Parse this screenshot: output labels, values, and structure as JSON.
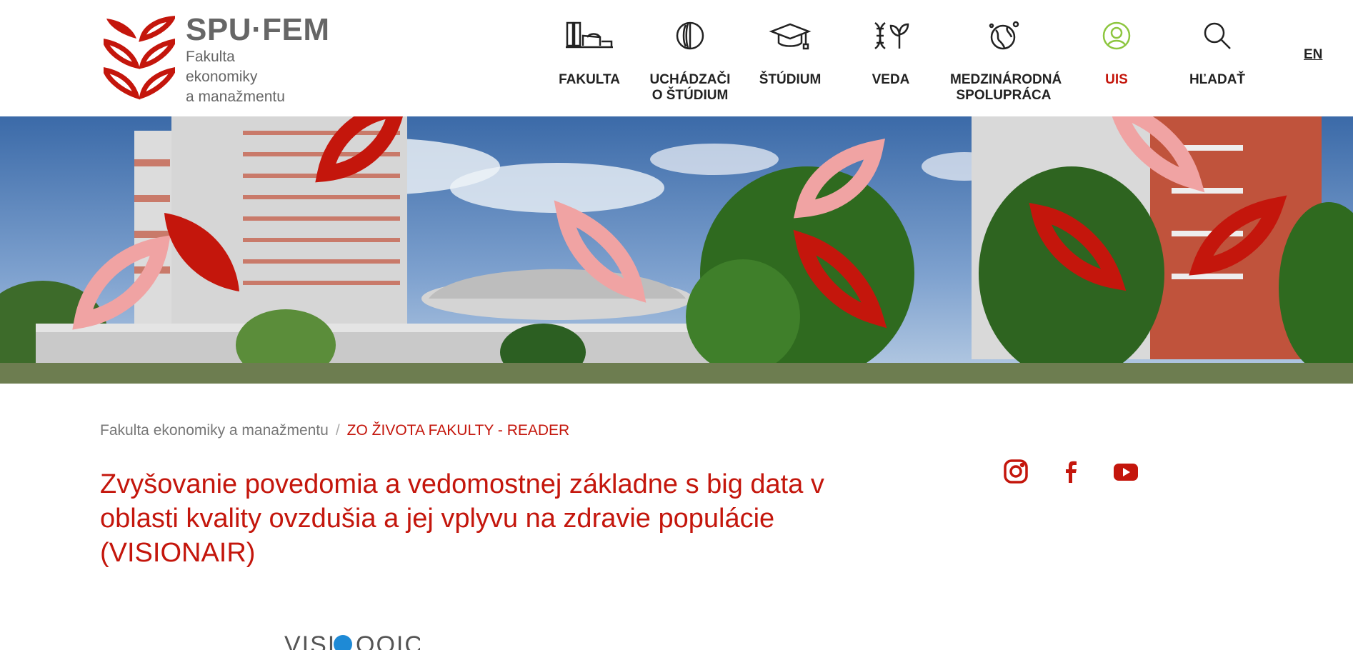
{
  "brand": {
    "title": "SPU·FEM",
    "subtitle_lines": [
      "Fakulta",
      "ekonomiky",
      "a manažmentu"
    ]
  },
  "nav": {
    "items": [
      {
        "label": "FAKULTA",
        "icon": "faculty-buildings-icon"
      },
      {
        "label": "UCHÁDZAČI",
        "label2": "O ŠTÚDIUM",
        "icon": "applicant-shield-icon"
      },
      {
        "label": "ŠTÚDIUM",
        "icon": "graduation-cap-icon"
      },
      {
        "label": "VEDA",
        "icon": "dna-plant-icon"
      },
      {
        "label": "MEDZINÁRODNÁ",
        "label2": "SPOLUPRÁCA",
        "icon": "globe-network-icon"
      },
      {
        "label": "UIS",
        "icon": "user-circle-icon",
        "active": true
      },
      {
        "label": "HĽADAŤ",
        "icon": "search-icon"
      }
    ],
    "lang": "EN"
  },
  "breadcrumb": {
    "home": "Fakulta ekonomiky a manažmentu",
    "separator": "/",
    "current": "ZO ŽIVOTA FAKULTY - READER"
  },
  "article": {
    "title": "Zvyšovanie povedomia a vedomostnej základne s big data v oblasti kvality ovzdušia a jej vplyvu na zdravie populácie (VISIONAIR)"
  },
  "social": [
    "instagram-icon",
    "facebook-icon",
    "youtube-icon"
  ],
  "colors": {
    "accent": "#c4160c",
    "petal_light": "#f0a3a3",
    "uis_icon": "#8dc63f"
  }
}
